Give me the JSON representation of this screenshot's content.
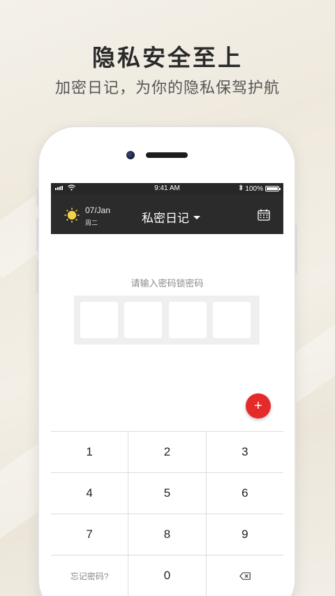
{
  "promo": {
    "headline": "隐私安全至上",
    "subline": "加密日记，为你的隐私保驾护航"
  },
  "status_bar": {
    "time": "9:41 AM",
    "battery": "100%",
    "icons": [
      "signal-icon",
      "wifi-icon",
      "bluetooth-icon",
      "battery-icon"
    ]
  },
  "app_bar": {
    "weather_icon": "sun-icon",
    "date": "07/Jan",
    "weekday": "周二",
    "title": "私密日记",
    "title_icon": "caret-down-icon",
    "right_icon": "calendar-icon"
  },
  "lock": {
    "prompt": "请输入密码锁密码",
    "pin_length": 4
  },
  "fab": {
    "label": "+",
    "icon": "add-icon",
    "color": "#e52a2a"
  },
  "keypad": {
    "rows": [
      [
        "1",
        "2",
        "3"
      ],
      [
        "4",
        "5",
        "6"
      ],
      [
        "7",
        "8",
        "9"
      ]
    ],
    "forgot": "忘记密码?",
    "zero": "0",
    "backspace_icon": "backspace-icon"
  },
  "colors": {
    "app_bar": "#2b2b2b",
    "accent": "#e52a2a",
    "sun": "#f3d34a"
  }
}
